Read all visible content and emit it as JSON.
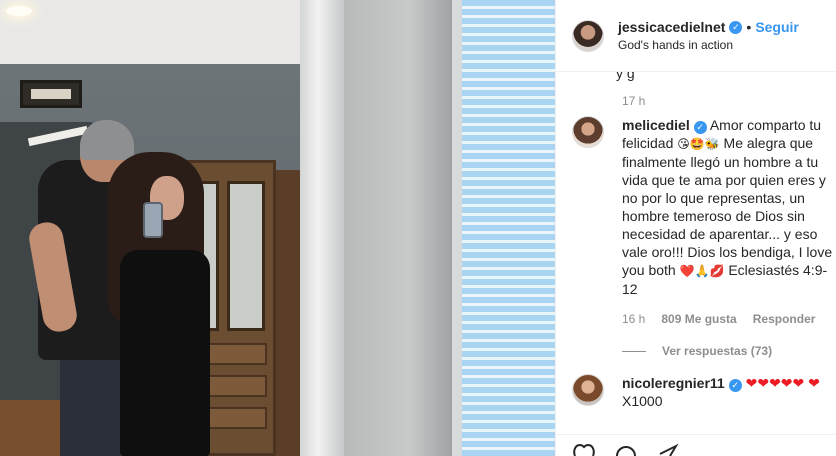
{
  "post": {
    "username": "jessicacedielnet",
    "verified_badge": "✓",
    "separator": "•",
    "follow_label": "Seguir",
    "location": "God's hands in action",
    "cut_text": "y g",
    "top_timestamp": "17 h"
  },
  "comments": [
    {
      "username": "melicediel",
      "verified_badge": "✓",
      "text_1": " Amor comparto tu felicidad ",
      "emoji_1": "😘🤩🐝",
      "text_2": " Me alegra que finalmente llegó un hombre a tu vida que te ama por quien eres y no por lo que representas, un hombre temeroso de Dios sin necesidad de aparentar... y eso vale oro!!! Dios los bendiga, I love you both ",
      "emoji_2": "❤️🙏💋",
      "text_3": " Eclesiastés 4:9-12",
      "timestamp": "16 h",
      "likes": "809 Me gusta",
      "reply_label": "Responder",
      "view_replies": "Ver respuestas (73)"
    },
    {
      "username": "nicoleregnier11",
      "verified_badge": "✓",
      "hearts": "❤❤❤❤❤",
      "heart_2": "❤",
      "text": "X1000"
    }
  ],
  "icons": {
    "like": "heart-icon",
    "comment": "comment-icon",
    "share": "share-icon"
  },
  "colors": {
    "link": "#3897f0",
    "secondary_text": "#8e8e8e",
    "heart": "#ed1c24"
  }
}
